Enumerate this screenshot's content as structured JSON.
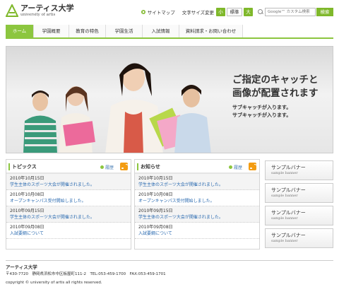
{
  "header": {
    "logo_text": "アーティス大学",
    "logo_sub": "university of artis",
    "sitemap_label": "サイトマップ",
    "font_size_label": "文字サイズ変更",
    "font_small": "小",
    "font_standard": "標準",
    "font_large": "大",
    "search_placeholder": "Google™ カスタム検索",
    "search_button": "検索"
  },
  "nav": {
    "items": [
      {
        "label": "ホーム"
      },
      {
        "label": "学園概要"
      },
      {
        "label": "教育の特色"
      },
      {
        "label": "学園生活"
      },
      {
        "label": "入試情報"
      },
      {
        "label": "資料請求・お問い合わせ"
      }
    ]
  },
  "hero": {
    "catch_line1": "ご指定のキャッチと",
    "catch_line2": "画像が配置されます",
    "sub_line1": "サブキャッチが入ります。",
    "sub_line2": "サブキャッチが入ります。"
  },
  "topics": {
    "title": "トピックス",
    "archive": "履歴",
    "items": [
      {
        "date": "2010年10月15日",
        "text": "学生主体のスポーツ大会が開催されました。"
      },
      {
        "date": "2010年10月08日",
        "text": "オープンキャンパス受付開始しました。"
      },
      {
        "date": "2010年09月15日",
        "text": "学生主体のスポーツ大会が開催されました。"
      },
      {
        "date": "2010年09月08日",
        "text": "入試要綱について"
      }
    ]
  },
  "notices": {
    "title": "お知らせ",
    "archive": "履歴",
    "items": [
      {
        "date": "2010年10月15日",
        "text": "学生主体のスポーツ大会が開催されました。"
      },
      {
        "date": "2010年10月08日",
        "text": "オープンキャンパス受付開始しました。"
      },
      {
        "date": "2010年09月15日",
        "text": "学生主体のスポーツ大会が開催されました。"
      },
      {
        "date": "2010年09月08日",
        "text": "入試要綱について"
      }
    ]
  },
  "banners": [
    {
      "title": "サンプルバナー",
      "sub": "sample banner"
    },
    {
      "title": "サンプルバナー",
      "sub": "sample banner"
    },
    {
      "title": "サンプルバナー",
      "sub": "sample banner"
    },
    {
      "title": "サンプルバナー",
      "sub": "sample banner"
    }
  ],
  "footer": {
    "name": "アーティス大学",
    "address": "〒430-7720　静岡県浜松市中区板屋町111-2　TEL:053-459-1700　FAX:053-459-1701",
    "copyright": "copyright © university of artis all rights reserved."
  },
  "colors": {
    "accent": "#8cc63f",
    "link": "#2a6ab0",
    "rss": "#f39c12"
  }
}
